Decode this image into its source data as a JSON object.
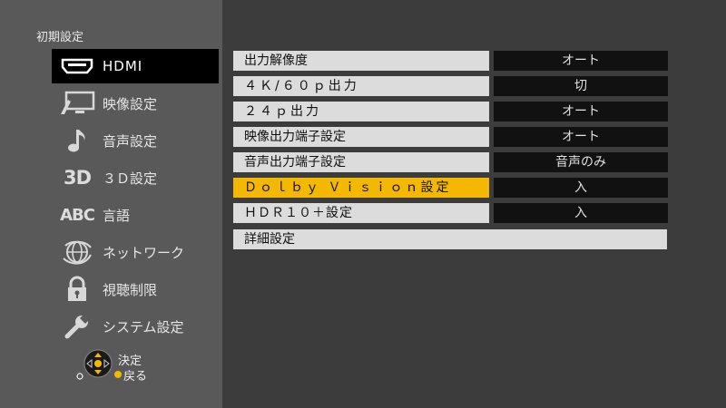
{
  "sidebar": {
    "title": "初期設定",
    "items": [
      {
        "label": "HDMI",
        "icon": "hdmi-port-icon"
      },
      {
        "label": "映像設定",
        "icon": "monitor-icon"
      },
      {
        "label": "音声設定",
        "icon": "music-note-icon"
      },
      {
        "label": "３Ｄ設定",
        "icon": "3d-icon",
        "icon_text": "3D"
      },
      {
        "label": "言語",
        "icon": "abc-icon",
        "icon_text": "ABC"
      },
      {
        "label": "ネットワーク",
        "icon": "globe-network-icon"
      },
      {
        "label": "視聴制限",
        "icon": "lock-icon"
      },
      {
        "label": "システム設定",
        "icon": "wrench-icon"
      }
    ]
  },
  "help": {
    "ok_label": "決定",
    "back_label": "戻る"
  },
  "settings": [
    {
      "label": "出力解像度",
      "value": "オート"
    },
    {
      "label": "４Ｋ/６０ｐ出力",
      "value": "切"
    },
    {
      "label": "２４ｐ出力",
      "value": "オート"
    },
    {
      "label": "映像出力端子設定",
      "value": "オート"
    },
    {
      "label": "音声出力端子設定",
      "value": "音声のみ"
    },
    {
      "label": "Ｄｏｌｂｙ Ｖｉｓｉｏｎ設定",
      "value": "入"
    },
    {
      "label": "ＨＤＲ１０＋設定",
      "value": "入"
    },
    {
      "label": "詳細設定"
    }
  ],
  "colors": {
    "highlight": "#f5b800",
    "sidebar_bg": "#595959",
    "main_bg": "#3c3c3c",
    "button_yellow": "#f5b800"
  }
}
